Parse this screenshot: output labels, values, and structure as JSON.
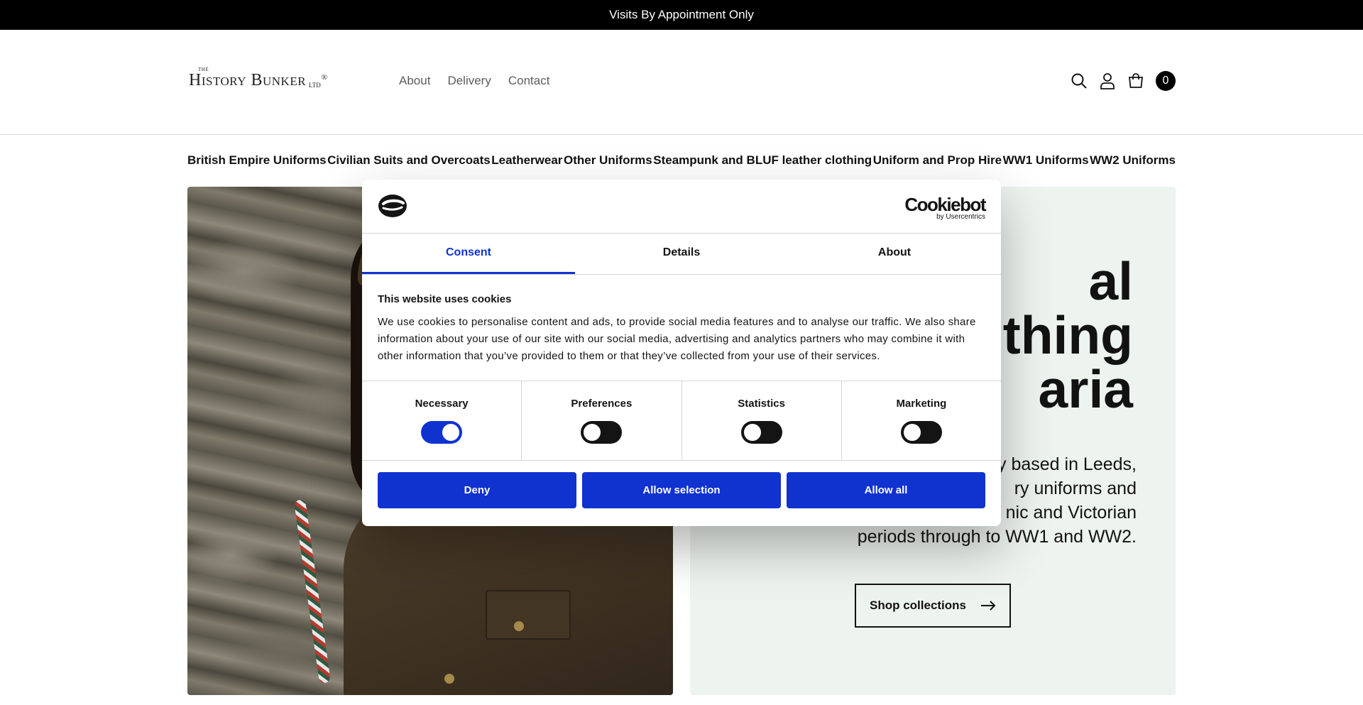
{
  "announcement": "Visits By Appointment Only",
  "logo": {
    "the": "THE",
    "name": "History Bunker",
    "ltd": "ltd",
    "reg": "®"
  },
  "topnav": [
    "About",
    "Delivery",
    "Contact"
  ],
  "cart": {
    "count": "0"
  },
  "categories": [
    "British Empire Uniforms",
    "Civilian Suits and Overcoats",
    "Leatherwear",
    "Other Uniforms",
    "Steampunk and BLUF leather clothing",
    "Uniform and Prop Hire",
    "WW1 Uniforms",
    "WW2 Uniforms"
  ],
  "hero": {
    "title": "al\nothing\naria",
    "text": "y based in Leeds,\nry uniforms and\nnic and Victorian\nperiods through to WW1 and WW2.",
    "cta": "Shop collections"
  },
  "cookie": {
    "brand": "Cookiebot",
    "brand_sub": "by Usercentrics",
    "tabs": [
      "Consent",
      "Details",
      "About"
    ],
    "active_tab": "Consent",
    "heading": "This website uses cookies",
    "body": "We use cookies to personalise content and ads, to provide social media features and to analyse our traffic. We also share information about your use of our site with our social media, advertising and analytics partners who may combine it with other information that you’ve provided to them or that they’ve collected from your use of their services.",
    "toggles": [
      {
        "label": "Necessary",
        "on": true
      },
      {
        "label": "Preferences",
        "on": false
      },
      {
        "label": "Statistics",
        "on": false
      },
      {
        "label": "Marketing",
        "on": false
      }
    ],
    "buttons": [
      "Deny",
      "Allow selection",
      "Allow all"
    ],
    "accent": "#1032cf"
  },
  "icons": [
    "search-icon",
    "account-icon",
    "cart-icon",
    "arrow-right-icon",
    "cookie-logo-icon"
  ]
}
